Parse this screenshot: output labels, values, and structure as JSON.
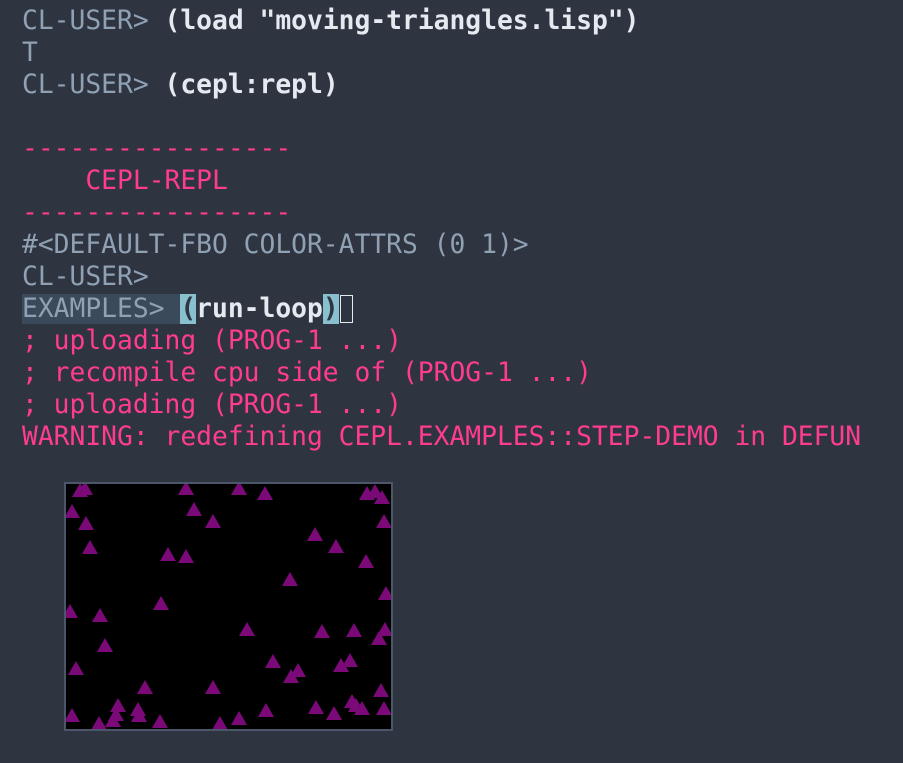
{
  "colors": {
    "background": "#2e3440",
    "prompt": "#8fa1b3",
    "input": "#e5e9f0",
    "accent_pink": "#ff3c8e",
    "triangle": "#7b0a78",
    "viewport_bg": "#000000"
  },
  "repl": {
    "line1": {
      "prompt": "CL-USER> ",
      "input": "(load \"moving-triangles.lisp\")"
    },
    "line2": {
      "output": "T"
    },
    "line3": {
      "prompt": "CL-USER> ",
      "input": "(cepl:repl)"
    },
    "banner": {
      "rule": "-----------------",
      "title": "    CEPL-REPL"
    },
    "fbo_output": "#<DEFAULT-FBO COLOR-ATTRS (0 1)>",
    "line_cl_user": "CL-USER>",
    "current": {
      "prompt": "EXAMPLES> ",
      "open_paren": "(",
      "input_body": "run-loop",
      "close_paren": ")"
    },
    "messages": [
      "; uploading (PROG-1 ...)",
      "; recompile cpu side of (PROG-1 ...)",
      "; uploading (PROG-1 ...)",
      "WARNING: redefining CEPL.EXAMPLES::STEP-DEMO in DEFUN"
    ]
  },
  "viewport": {
    "triangle_icon": "triangle-icon"
  }
}
